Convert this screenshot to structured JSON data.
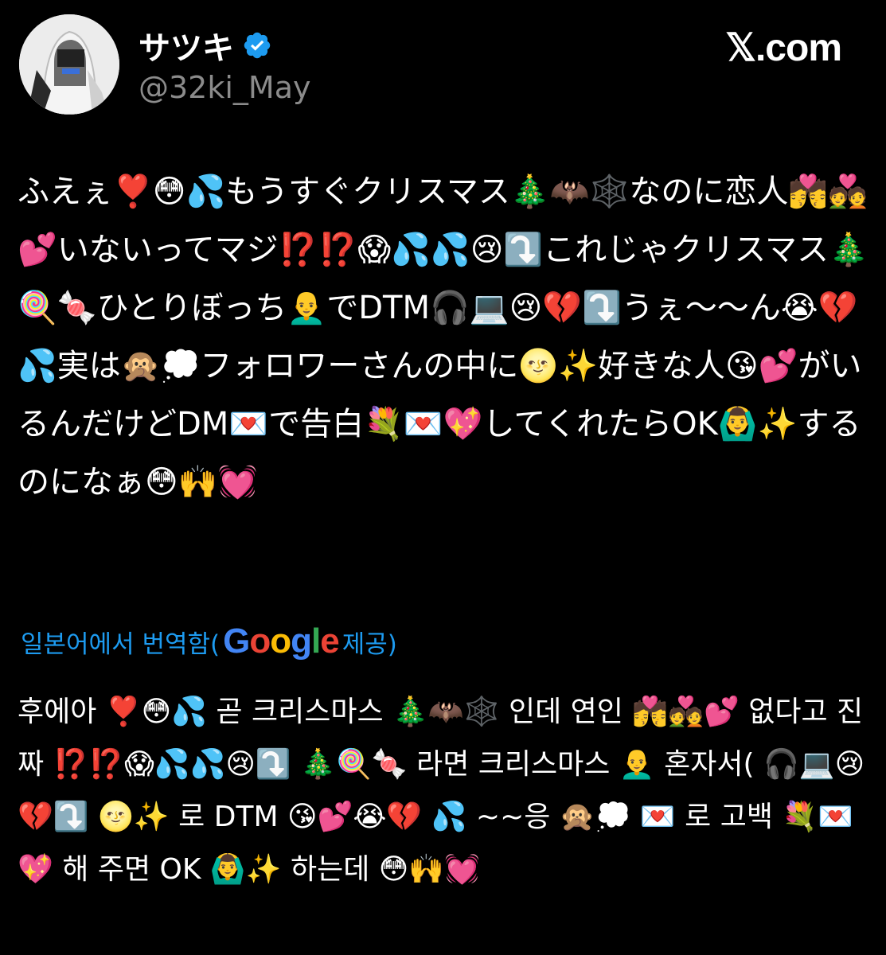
{
  "account": {
    "display_name": "サツキ",
    "handle": "@32ki_May",
    "verified": true,
    "avatar": "avatar-image"
  },
  "brand": {
    "label": "𝕏.com"
  },
  "tweet": {
    "text": "ふえぇ❣️😳💦もうすぐクリスマス🎄🦇🕸️なのに恋人💏💑💕いないってマジ⁉️⁉️😱💦💦😢⤵️これじゃクリスマス🎄🍭🍬ひとりぼっち👨‍🦲でDTM🎧💻😢💔⤵️うぇ～～ん😭💔💦実は🙊💭フォロワーさんの中に🌝✨好きな人😘💕がいるんだけどDM💌で告白💐💌💖してくれたらOK🙆‍♂️✨するのになぁ😳🙌💓"
  },
  "translation": {
    "label_prefix": "일본어에서 번역함(",
    "provider": "Google",
    "label_suffix": " 제공)",
    "text": "후에아 ❣️😳💦 곧 크리스마스 🎄🦇🕸️ 인데 연인 💏💑💕 없다고 진짜 ⁉️⁉️😱💦💦😢⤵️ 🎄🍭🍬 라면 크리스마스 👨‍🦲 혼자서( 🎧💻😢💔⤵️ 🌝✨ 로 DTM 😘💕😭💔 💦 ~~응 🙊💭 💌 로 고백 💐💌💖 해 주면 OK 🙆‍♂️✨ 하는데 😳🙌💓"
  },
  "colors": {
    "background": "#000000",
    "text": "#ffffff",
    "handle": "#8b8b8b",
    "link": "#1d9bf0",
    "verified": "#1d9bf0"
  }
}
